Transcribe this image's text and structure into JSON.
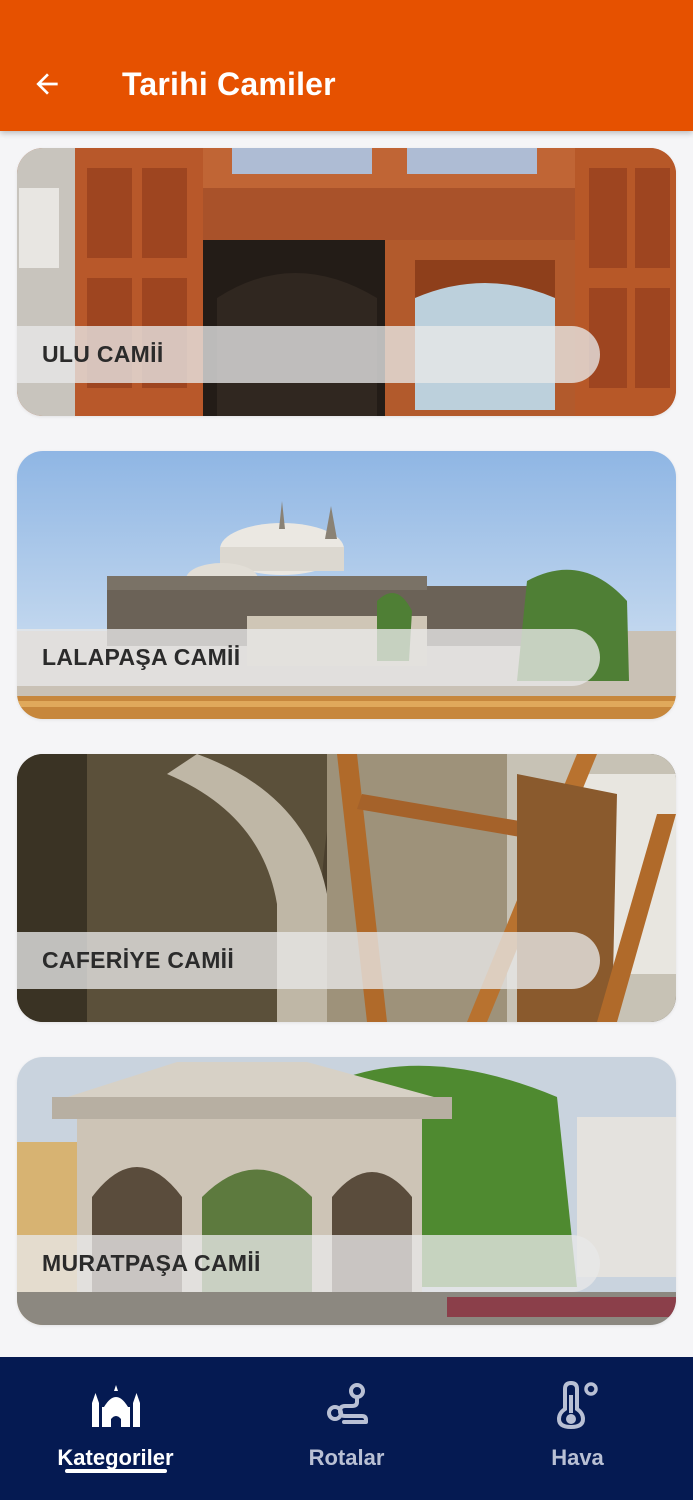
{
  "colors": {
    "appbar": "#e65100",
    "bottom_nav": "#051a52",
    "nav_active": "#ffffff",
    "nav_inactive": "#b9c0d4",
    "background": "#f5f5f7"
  },
  "appbar": {
    "title": "Tarihi Camiler",
    "back_icon": "arrow-left-icon"
  },
  "cards": [
    {
      "label": "ULU CAMİİ",
      "image": "mosque-carved-wooden-door-photo"
    },
    {
      "label": "LALAPAŞA CAMİİ",
      "image": "mosque-domes-exterior-photo"
    },
    {
      "label": "CAFERİYE CAMİİ",
      "image": "mosque-stone-arch-interior-photo"
    },
    {
      "label": "MURATPAŞA CAMİİ",
      "image": "mosque-fountain-pavilion-photo"
    }
  ],
  "bottom_nav": {
    "items": [
      {
        "label": "Kategoriler",
        "icon": "mosque-icon",
        "active": true
      },
      {
        "label": "Rotalar",
        "icon": "route-icon",
        "active": false
      },
      {
        "label": "Hava",
        "icon": "thermometer-icon",
        "active": false
      }
    ]
  }
}
